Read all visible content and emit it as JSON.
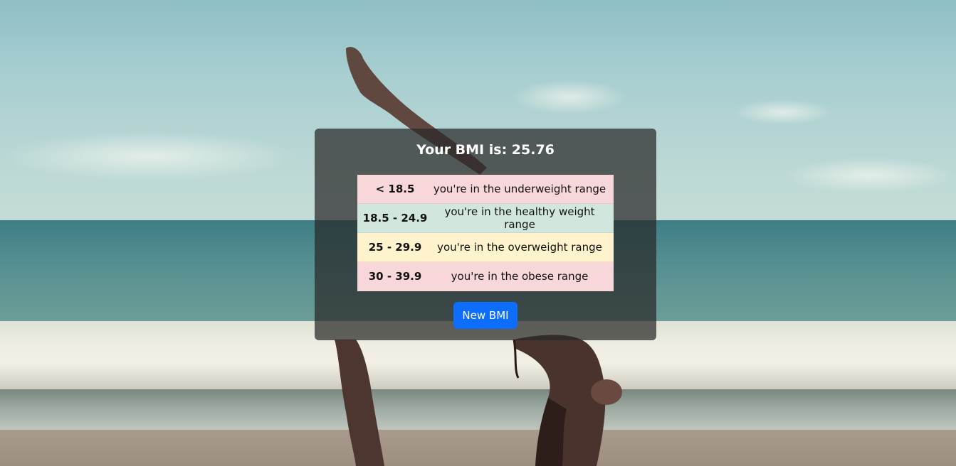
{
  "result": {
    "title": "Your BMI is: 25.76"
  },
  "ranges": [
    {
      "range": "< 18.5",
      "description": "you're in the underweight range",
      "color": "#f8d7da"
    },
    {
      "range": "18.5 - 24.9",
      "description": "you're in the healthy weight range",
      "color": "#d1e7dd"
    },
    {
      "range": "25 - 29.9",
      "description": "you're in the overweight range",
      "color": "#fff3cd"
    },
    {
      "range": "30 - 39.9",
      "description": "you're in the obese range",
      "color": "#f8d7da"
    }
  ],
  "actions": {
    "new_bmi_label": "New BMI"
  },
  "colors": {
    "button_primary": "#0d6efd",
    "card_overlay": "#282828"
  }
}
